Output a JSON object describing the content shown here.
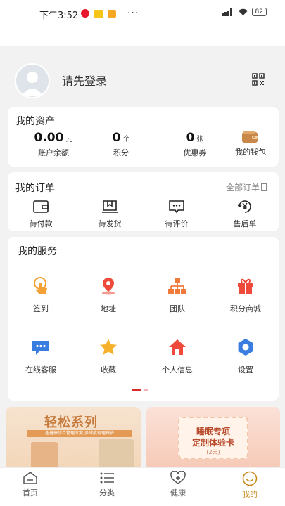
{
  "status_bar": {
    "time": "下午3:52",
    "battery": "82",
    "more": "···"
  },
  "profile": {
    "login_prompt": "请先登录"
  },
  "assets": {
    "title": "我的资产",
    "balance": {
      "value": "0.00",
      "unit": "元",
      "label": "账户余额"
    },
    "points": {
      "value": "0",
      "unit": "个",
      "label": "积分"
    },
    "coupons": {
      "value": "0",
      "unit": "张",
      "label": "优惠券"
    },
    "wallet_label": "我的钱包"
  },
  "orders": {
    "title": "我的订单",
    "all_orders": "全部订单",
    "items": [
      {
        "label": "待付款",
        "icon": "wallet-outline-icon"
      },
      {
        "label": "待发货",
        "icon": "box-outline-icon"
      },
      {
        "label": "待评价",
        "icon": "comment-outline-icon"
      },
      {
        "label": "售后单",
        "icon": "yuan-refund-icon"
      }
    ]
  },
  "services": {
    "title": "我的服务",
    "items": [
      {
        "label": "签到",
        "icon": "tap-hand-icon"
      },
      {
        "label": "地址",
        "icon": "location-pin-icon"
      },
      {
        "label": "团队",
        "icon": "team-tree-icon"
      },
      {
        "label": "积分商城",
        "icon": "gift-icon"
      },
      {
        "label": "在线客服",
        "icon": "chat-bubble-icon"
      },
      {
        "label": "收藏",
        "icon": "star-icon"
      },
      {
        "label": "个人信息",
        "icon": "home-icon"
      },
      {
        "label": "设置",
        "icon": "settings-gear-icon"
      }
    ]
  },
  "banners": {
    "left": {
      "title": "轻松系列",
      "subtitle": "全健康综合管理方案 多维度调理养护"
    },
    "right": {
      "line1": "睡眠专项",
      "line2": "定制体验卡",
      "tag": "(2天)"
    }
  },
  "tabbar": {
    "items": [
      {
        "label": "首页"
      },
      {
        "label": "分类"
      },
      {
        "label": "健康"
      },
      {
        "label": "我的"
      }
    ]
  },
  "colors": {
    "accent": "#c78a1e",
    "pager_active": "#d92b2b",
    "icon_blue": "#3a7de0",
    "icon_orange": "#f4a236",
    "icon_red": "#ef4a3c"
  }
}
